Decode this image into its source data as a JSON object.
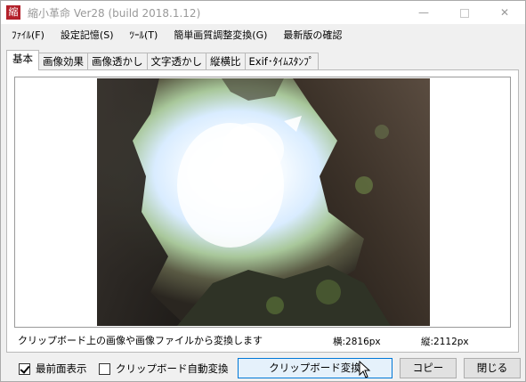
{
  "window": {
    "title": "縮小革命 Ver28 (build 2018.1.12)",
    "app_icon_char": "縮",
    "minimize_glyph": "—",
    "close_glyph": "✕"
  },
  "menu": [
    {
      "label": "ﾌｧｲﾙ(F)"
    },
    {
      "label": "設定記憶(S)"
    },
    {
      "label": "ﾂｰﾙ(T)"
    },
    {
      "label": "簡単画質調整変換(G)"
    },
    {
      "label": "最新版の確認"
    }
  ],
  "tabs": [
    {
      "label": "基本",
      "active": true
    },
    {
      "label": "画像効果"
    },
    {
      "label": "画像透かし"
    },
    {
      "label": "文字透かし"
    },
    {
      "label": "縦横比"
    },
    {
      "label": "Exif･ﾀｲﾑｽﾀﾝﾌﾟ"
    }
  ],
  "preview": {
    "image_icon": "cave-photo-image"
  },
  "status": {
    "message": "クリップボード上の画像や画像ファイルから変換します",
    "width_text": "横:2816px",
    "height_text": "縦:2112px"
  },
  "options": {
    "always_on_top": {
      "label": "最前面表示",
      "checked": true
    },
    "clipboard_auto": {
      "label": "クリップボード自動変換",
      "checked": false
    }
  },
  "buttons": {
    "clipboard_convert": "クリップボード変換",
    "copy": "コピー",
    "close": "閉じる"
  },
  "colors": {
    "app_icon_bg": "#b3202a",
    "default_button_border": "#0078d7"
  }
}
